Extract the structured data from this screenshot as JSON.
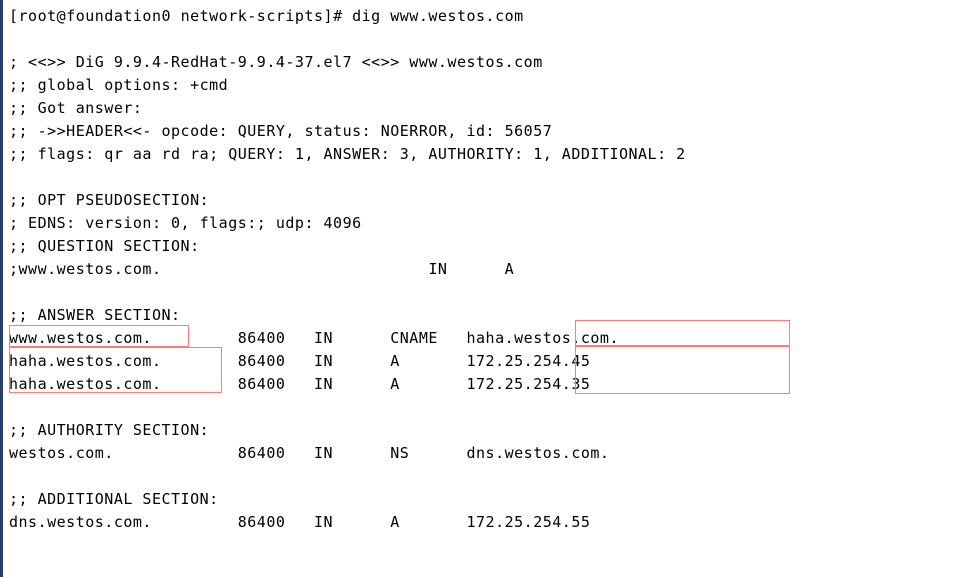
{
  "prompt": {
    "user": "root",
    "host": "foundation0",
    "cwd": "network-scripts",
    "symbol": "#",
    "command": "dig www.westos.com"
  },
  "banner": {
    "line": "; <<>> DiG 9.9.4-RedHat-9.9.4-37.el7 <<>> www.westos.com",
    "global_options": ";; global options: +cmd",
    "got_answer": ";; Got answer:",
    "header": ";; ->>HEADER<<- opcode: QUERY, status: NOERROR, id: 56057",
    "flags": ";; flags: qr aa rd ra; QUERY: 1, ANSWER: 3, AUTHORITY: 1, ADDITIONAL: 2"
  },
  "opt": {
    "header": ";; OPT PSEUDOSECTION:",
    "edns": "; EDNS: version: 0, flags:; udp: 4096"
  },
  "question": {
    "header": ";; QUESTION SECTION:",
    "record": {
      "name": ";www.westos.com.",
      "class": "IN",
      "type": "A"
    }
  },
  "answer": {
    "header": ";; ANSWER SECTION:",
    "records": [
      {
        "name": "www.westos.com.",
        "ttl": "86400",
        "class": "IN",
        "type": "CNAME",
        "data": "haha.westos.com."
      },
      {
        "name": "haha.westos.com.",
        "ttl": "86400",
        "class": "IN",
        "type": "A",
        "data": "172.25.254.45"
      },
      {
        "name": "haha.westos.com.",
        "ttl": "86400",
        "class": "IN",
        "type": "A",
        "data": "172.25.254.35"
      }
    ]
  },
  "authority": {
    "header": ";; AUTHORITY SECTION:",
    "records": [
      {
        "name": "westos.com.",
        "ttl": "86400",
        "class": "IN",
        "type": "NS",
        "data": "dns.westos.com."
      }
    ]
  },
  "additional": {
    "header": ";; ADDITIONAL SECTION:",
    "records": [
      {
        "name": "dns.westos.com.",
        "ttl": "86400",
        "class": "IN",
        "type": "A",
        "data": "172.25.254.55"
      }
    ]
  },
  "chart_data": {
    "type": "table",
    "title": "dig www.westos.com — DNS records",
    "columns": [
      "name",
      "ttl",
      "class",
      "type",
      "data"
    ],
    "rows": [
      [
        "www.westos.com.",
        "86400",
        "IN",
        "CNAME",
        "haha.westos.com."
      ],
      [
        "haha.westos.com.",
        "86400",
        "IN",
        "A",
        "172.25.254.45"
      ],
      [
        "haha.westos.com.",
        "86400",
        "IN",
        "A",
        "172.25.254.35"
      ],
      [
        "westos.com.",
        "86400",
        "IN",
        "NS",
        "dns.westos.com."
      ],
      [
        "dns.westos.com.",
        "86400",
        "IN",
        "A",
        "172.25.254.55"
      ]
    ]
  }
}
